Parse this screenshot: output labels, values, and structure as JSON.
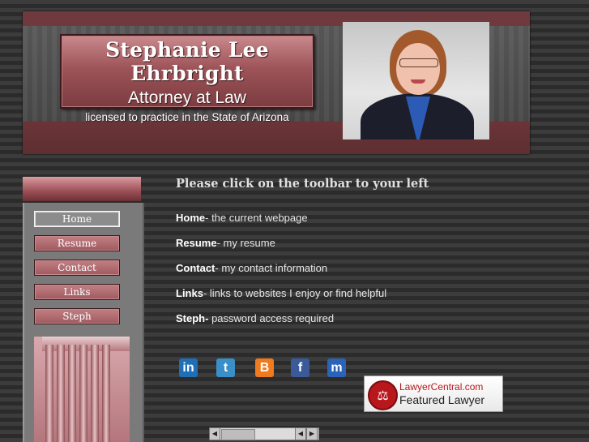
{
  "header": {
    "name": "Stephanie Lee Ehrbright",
    "role": "Attorney at Law",
    "license": "licensed to practice in the State of Arizona"
  },
  "nav": {
    "items": [
      {
        "label": "Home",
        "active": true
      },
      {
        "label": "Resume",
        "active": false
      },
      {
        "label": "Contact",
        "active": false
      },
      {
        "label": "Links",
        "active": false
      },
      {
        "label": "Steph",
        "active": false
      }
    ]
  },
  "content": {
    "heading": "Please click on the toolbar to your left",
    "lines": [
      {
        "term": "Home",
        "desc": "- the current webpage"
      },
      {
        "term": "Resume",
        "desc": "- my resume"
      },
      {
        "term": "Contact",
        "desc": "- my contact information"
      },
      {
        "term": "Links",
        "desc": "- links to websites I enjoy or find helpful"
      },
      {
        "term": "Steph-",
        "desc": " password access required"
      }
    ]
  },
  "social": [
    {
      "icon": "linkedin-icon",
      "glyph": "in",
      "color": "#1e6fb5"
    },
    {
      "icon": "twitter-icon",
      "glyph": "t",
      "color": "#3a8fc9"
    },
    {
      "icon": "blogger-icon",
      "glyph": "B",
      "color": "#f07a1e"
    },
    {
      "icon": "facebook-icon",
      "glyph": "f",
      "color": "#3b5a9a"
    },
    {
      "icon": "myspace-icon",
      "glyph": "m",
      "color": "#2a63b8"
    }
  ],
  "badge": {
    "line1": "LawyerCentral.com",
    "line2": "Featured Lawyer"
  },
  "colors": {
    "accent": "#9e5459",
    "background_stripe_light": "#3c3c3c",
    "background_stripe_dark": "#2b2b2b"
  }
}
